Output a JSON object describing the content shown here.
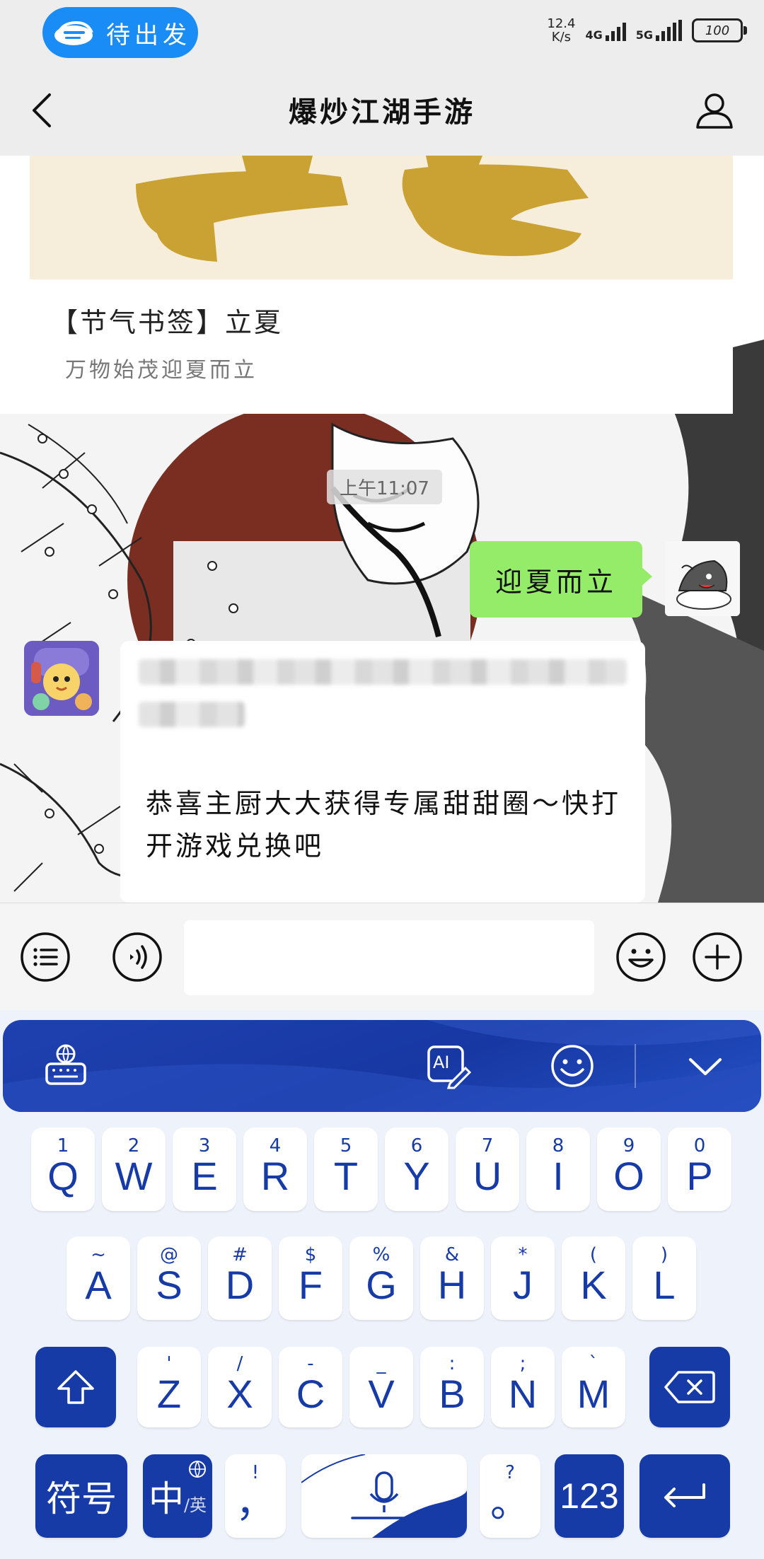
{
  "status_bar": {
    "pill_label": "待出发",
    "speed_value": "12.4",
    "speed_unit": "K/s",
    "net1": "4G",
    "net2": "5G",
    "battery": "100"
  },
  "nav": {
    "title": "爆炒江湖手游"
  },
  "chat": {
    "card": {
      "title": "【节气书签】立夏",
      "subtitle": "万物始茂迎夏而立"
    },
    "timestamp": "上午11:07",
    "my_message": "迎夏而立",
    "incoming_message": "恭喜主厨大大获得专属甜甜圈～快打开游戏兑换吧"
  },
  "keyboard": {
    "row1": [
      {
        "main": "Q",
        "sup": "1"
      },
      {
        "main": "W",
        "sup": "2"
      },
      {
        "main": "E",
        "sup": "3"
      },
      {
        "main": "R",
        "sup": "4"
      },
      {
        "main": "T",
        "sup": "5"
      },
      {
        "main": "Y",
        "sup": "6"
      },
      {
        "main": "U",
        "sup": "7"
      },
      {
        "main": "I",
        "sup": "8"
      },
      {
        "main": "O",
        "sup": "9"
      },
      {
        "main": "P",
        "sup": "0"
      }
    ],
    "row2": [
      {
        "main": "A",
        "sup": "~"
      },
      {
        "main": "S",
        "sup": "@"
      },
      {
        "main": "D",
        "sup": "#"
      },
      {
        "main": "F",
        "sup": "$"
      },
      {
        "main": "G",
        "sup": "%"
      },
      {
        "main": "H",
        "sup": "&"
      },
      {
        "main": "J",
        "sup": "*"
      },
      {
        "main": "K",
        "sup": "("
      },
      {
        "main": "L",
        "sup": ")"
      }
    ],
    "row3": [
      {
        "main": "Z",
        "sup": "'"
      },
      {
        "main": "X",
        "sup": "/"
      },
      {
        "main": "C",
        "sup": "-"
      },
      {
        "main": "V",
        "sup": "_"
      },
      {
        "main": "B",
        "sup": ":"
      },
      {
        "main": "N",
        "sup": ";"
      },
      {
        "main": "M",
        "sup": "`"
      }
    ],
    "symbols_label": "符号",
    "lang_main": "中",
    "lang_alt": "/英",
    "comma_main": "，",
    "comma_sup": "!",
    "period_main": "。",
    "period_sup": "?",
    "num_label": "123"
  },
  "colors": {
    "accent": "#163aa6",
    "my_bubble": "#95ec69",
    "pill": "#1a8cf5"
  }
}
